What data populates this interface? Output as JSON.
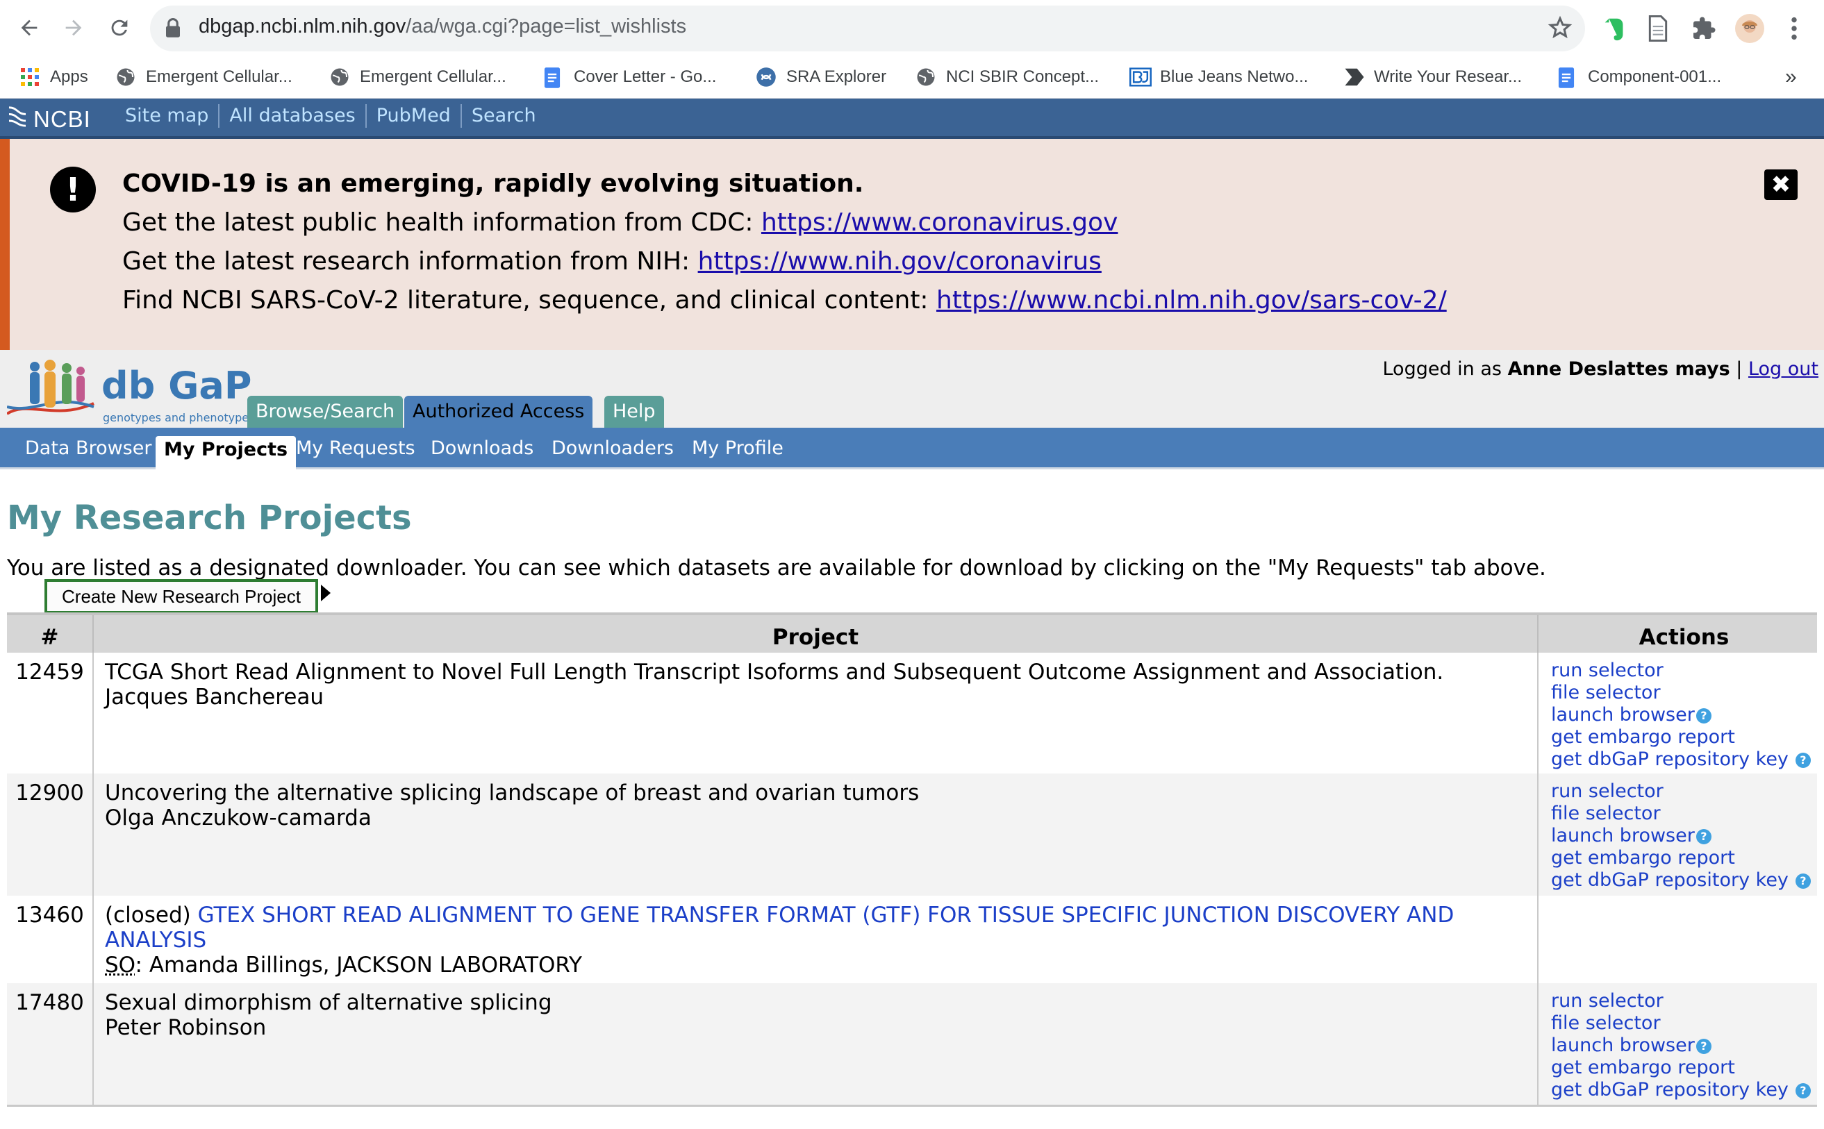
{
  "browser": {
    "url_host": "dbgap.ncbi.nlm.nih.gov",
    "url_path": "/aa/wga.cgi?page=list_wishlists",
    "bookmarks": [
      {
        "label": "Apps",
        "icon": "apps-grid-icon"
      },
      {
        "label": "Emergent Cellular...",
        "icon": "globe-icon"
      },
      {
        "label": "Emergent Cellular...",
        "icon": "globe-icon"
      },
      {
        "label": "Cover Letter - Go...",
        "icon": "google-docs-icon"
      },
      {
        "label": "SRA Explorer",
        "icon": "sra-icon"
      },
      {
        "label": "NCI SBIR Concept...",
        "icon": "globe-icon"
      },
      {
        "label": "Blue Jeans Netwo...",
        "icon": "bluejeans-icon"
      },
      {
        "label": "Write Your Resear...",
        "icon": "write-icon"
      },
      {
        "label": "Component-001...",
        "icon": "google-docs-icon"
      }
    ],
    "bookmarks_overflow": "»"
  },
  "ncbi": {
    "logo": "NCBI",
    "links": [
      "Site map",
      "All databases",
      "PubMed",
      "Search"
    ]
  },
  "covid": {
    "title": "COVID-19 is an emerging, rapidly evolving situation.",
    "line1_text": "Get the latest public health information from CDC: ",
    "line1_link": "https://www.coronavirus.gov",
    "line2_text": "Get the latest research information from NIH: ",
    "line2_link": "https://www.nih.gov/coronavirus",
    "line3_text": "Find NCBI SARS-CoV-2 literature, sequence, and clinical content: ",
    "line3_link": "https://www.ncbi.nlm.nih.gov/sars-cov-2/",
    "close_label": "✖"
  },
  "dbgap": {
    "logo_main": "db GaP",
    "logo_sub": "genotypes and phenotypes",
    "logged_in_prefix": "Logged in as ",
    "user_name": "Anne Deslattes mays",
    "separator": " | ",
    "logout_label": "Log out",
    "main_tabs": [
      "Browse/Search",
      "Authorized Access",
      "Help"
    ],
    "sub_tabs": [
      "Data Browser",
      "My Projects",
      "My Requests",
      "Downloads",
      "Downloaders",
      "My Profile"
    ]
  },
  "content": {
    "title": "My Research Projects",
    "intro": "You are listed as a designated downloader. You can see which datasets are available for download by clicking on the \"My Requests\" tab above.",
    "create_button": "Create New Research Project",
    "table_headers": [
      "#",
      "Project",
      "Actions"
    ],
    "rows": [
      {
        "id": "12459",
        "title": "TCGA Short Read Alignment to Novel Full Length Transcript Isoforms and Subsequent Outcome Assignment and Association.",
        "person": "Jacques Banchereau",
        "actions": [
          "run selector",
          "file selector",
          "launch browser",
          "get embargo report",
          "get dbGaP repository key"
        ]
      },
      {
        "id": "12900",
        "title": "Uncovering the alternative splicing landscape of breast and ovarian tumors",
        "person": "Olga Anczukow-camarda",
        "actions": [
          "run selector",
          "file selector",
          "launch browser",
          "get embargo report",
          "get dbGaP repository key"
        ]
      },
      {
        "id": "13460",
        "status": "(closed) ",
        "title": "GTEX SHORT READ ALIGNMENT TO GENE TRANSFER FORMAT (GTF) FOR TISSUE SPECIFIC JUNCTION DISCOVERY AND ANALYSIS",
        "so_label": "SO",
        "person": ": Amanda Billings, JACKSON LABORATORY",
        "actions": []
      },
      {
        "id": "17480",
        "title": "Sexual dimorphism of alternative splicing",
        "person": "Peter Robinson",
        "actions": [
          "run selector",
          "file selector",
          "launch browser",
          "get embargo report",
          "get dbGaP repository key"
        ]
      }
    ]
  },
  "colors": {
    "ncbi_bar": "#3b6394",
    "banner_bg": "#f1e3dd",
    "banner_accent": "#d45a1f",
    "title_teal": "#4f8f96",
    "tab_teal": "#5a9e98",
    "subnav_blue": "#4a7db8",
    "link_blue": "#1b3fc8"
  }
}
